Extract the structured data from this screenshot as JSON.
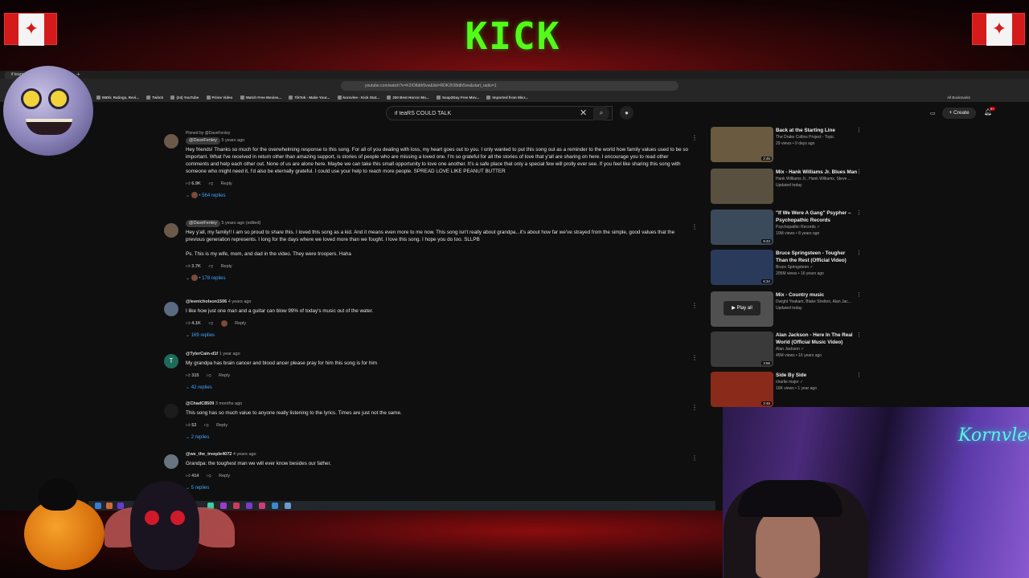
{
  "overlay": {
    "logo_text": "KICK"
  },
  "browser": {
    "tab_title": "if tears could talk",
    "url": "youtube.com/watch?v=K2IO8dth5vw&list=RDK2IO8dth5vw&start_radio=1",
    "bookmarks": [
      "IMDb: Ratings, Revi...",
      "Twitch",
      "(24) YouTube",
      "Prime Video",
      "Watch Free Movies...",
      "TikTok - Make Your...",
      "kornvlee - Kick Stat...",
      "200 Best Horror Mo...",
      "Soap2Day Free Mov...",
      "Imported from Micr...",
      "All Bookmarks"
    ]
  },
  "youtube": {
    "search_value": "if teaRS COULD TALK",
    "create_label": "Create",
    "notification_badge": "9+"
  },
  "comments": [
    {
      "pinned": "Pinned by @DaveFenley",
      "author": "@DaveFenley",
      "time": "5 years ago",
      "text": "Hey friends! Thanks so much for the overwhelming response to this song. For all of you dealing with loss, my heart goes out to you. I only wanted to put this song out as a reminder to the world how family values used to be so important. What I've received in return other than amazing support, is stories of people who are missing a loved one. I'm so grateful for all the stories of love that y'all are sharing on here. I encourage you to read other comments and help each other out. None of us are alone here. Maybe we can take this small opportunity to love one another. It's a safe place that only a special few will prolly ever see. If you feel like sharing this song with someone who might need it, I'd also be eternally grateful. I could use your help to reach more people. SPREAD LOVE LIKE PEANUT BUTTER",
      "likes": "6.9K",
      "reply": "Reply",
      "replies": "564 replies"
    },
    {
      "author": "@DaveFenley",
      "time": "5 years ago (edited)",
      "text": "Hey y'all, my family!! I am so proud to share this. I loved this song as a kid. And it means even more to me now. This song isn't really about grandpa...it's about how far we've strayed from the simple, good values that the previous generation represents. I long for the days where we loved more than we fought. I love this song. I hope you do too. SLLPB",
      "text2": "Ps. This is my wife, mom, and dad in the video. They were troopers. Haha",
      "likes": "3.7K",
      "reply": "Reply",
      "replies": "178 replies"
    },
    {
      "author": "@leenicholson1506",
      "time": "4 years ago",
      "text": "I like how just one man and a guitar can blow 99% of today's music out of the water.",
      "likes": "4.1K",
      "reply": "Reply",
      "replies": "169 replies"
    },
    {
      "avatar_letter": "T",
      "author": "@TylerCain-d1f",
      "time": "1 year ago",
      "text": "My grandpa has brain cancer and blood ancer please pray for him this song is for him",
      "likes": "315",
      "reply": "Reply",
      "replies": "42 replies"
    },
    {
      "author": "@ChadC8509",
      "time": "3 months ago",
      "text": "This song has so much value to anyone really listening to the lyrics. Times are just not the same.",
      "likes": "52",
      "reply": "Reply",
      "replies": "2 replies"
    },
    {
      "author": "@we_the_treeple4072",
      "time": "4 years ago",
      "text": "Grandpa: the toughest man we will ever know besides our father.",
      "likes": "414",
      "reply": "Reply",
      "replies": "5 replies"
    }
  ],
  "related": [
    {
      "title": "Back at the Starting Line",
      "channel": "The Drake Collins Project - Topic",
      "meta": "29 views • 9 days ago",
      "duration": "2:45",
      "color": "#6a5a40"
    },
    {
      "title": "Mix - Hank Williams Jr. Blues Man",
      "channel": "Hank Williams Jr., Hank Williams, Steve ...",
      "meta": "Updated today",
      "duration": "",
      "color": "#5a5040"
    },
    {
      "title": "\"If We Were A Gang\" Psypher – Psychopathic Records",
      "channel": "Psychopathic Records ✓",
      "meta": "10M views • 8 years ago",
      "duration": "9:43",
      "color": "#3a4a5a"
    },
    {
      "title": "Bruce Springsteen - Tougher Than the Rest (Official Video)",
      "channel": "Bruce Springsteen ✓",
      "meta": "205M views • 16 years ago",
      "duration": "6:34",
      "color": "#2a3a5a"
    },
    {
      "title": "Mix - Country music",
      "channel": "Dwight Yoakam, Blake Shelton, Alan Jac...",
      "meta": "Updated today",
      "duration": "",
      "play_all": "Play all",
      "color": "#505050"
    },
    {
      "title": "Alan Jackson - Here In The Real World (Official Music Video)",
      "channel": "Alan Jackson ✓",
      "meta": "45M views • 16 years ago",
      "duration": "3:55",
      "color": "#3a3a3a"
    },
    {
      "title": "Side By Side",
      "channel": "charlie major ✓",
      "meta": "16K views • 1 year ago",
      "duration": "3:45",
      "color": "#8a2a1a"
    }
  ],
  "webcam": {
    "neon_sign": "Kornvlee"
  }
}
